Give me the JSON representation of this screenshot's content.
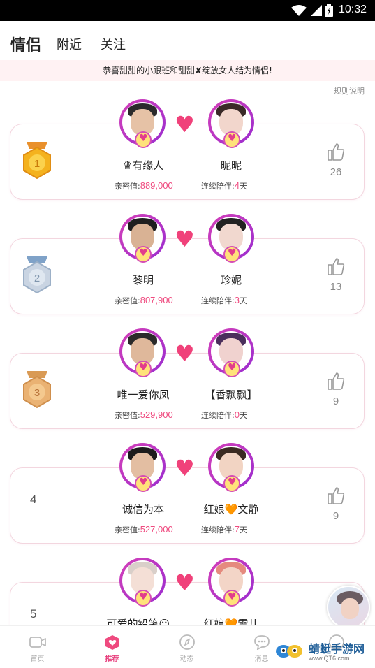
{
  "status_bar": {
    "time": "10:32"
  },
  "tabs": [
    {
      "label": "情侣",
      "active": true
    },
    {
      "label": "附近",
      "active": false
    },
    {
      "label": "关注",
      "active": false
    }
  ],
  "notice": "恭喜甜甜的小跟班和甜甜✘绽放女人结为情侣!",
  "rules_link": "规则说明",
  "labels": {
    "intimacy": "亲密值:",
    "streak": "连续陪伴:",
    "days_suffix": "天"
  },
  "entries": [
    {
      "rank": "1",
      "left_name": "♛有缘人",
      "right_name": "昵昵",
      "intimacy": "889,000",
      "streak": "4",
      "likes": "26"
    },
    {
      "rank": "2",
      "left_name": "黎明",
      "right_name": "珍妮",
      "intimacy": "807,900",
      "streak": "3",
      "likes": "13"
    },
    {
      "rank": "3",
      "left_name": "唯一爱你凤",
      "right_name": "【香飘飘】",
      "intimacy": "529,900",
      "streak": "0",
      "likes": "9"
    },
    {
      "rank": "4",
      "left_name": "诚信为本",
      "right_name": "红娘🧡文静",
      "intimacy": "527,000",
      "streak": "7",
      "likes": "9"
    },
    {
      "rank": "5",
      "left_name": "可爱的铅笔😶...",
      "right_name": "红娘🧡雪儿"
    }
  ],
  "bottom_nav": [
    {
      "label": "首页",
      "icon": "video-icon",
      "active": false
    },
    {
      "label": "推荐",
      "icon": "heart-icon",
      "active": true
    },
    {
      "label": "动态",
      "icon": "compass-icon",
      "active": false
    },
    {
      "label": "消息",
      "icon": "chat-icon",
      "active": false
    },
    {
      "label": "",
      "icon": "profile-icon",
      "active": false
    }
  ],
  "watermark": {
    "text": "蜻蜓手游网",
    "url": "www.QT6.com"
  },
  "colors": {
    "accent": "#ef4a7f",
    "avatar_ring": "#c63fc3",
    "heart": "#f0417a",
    "card_border": "#f3d6df"
  }
}
